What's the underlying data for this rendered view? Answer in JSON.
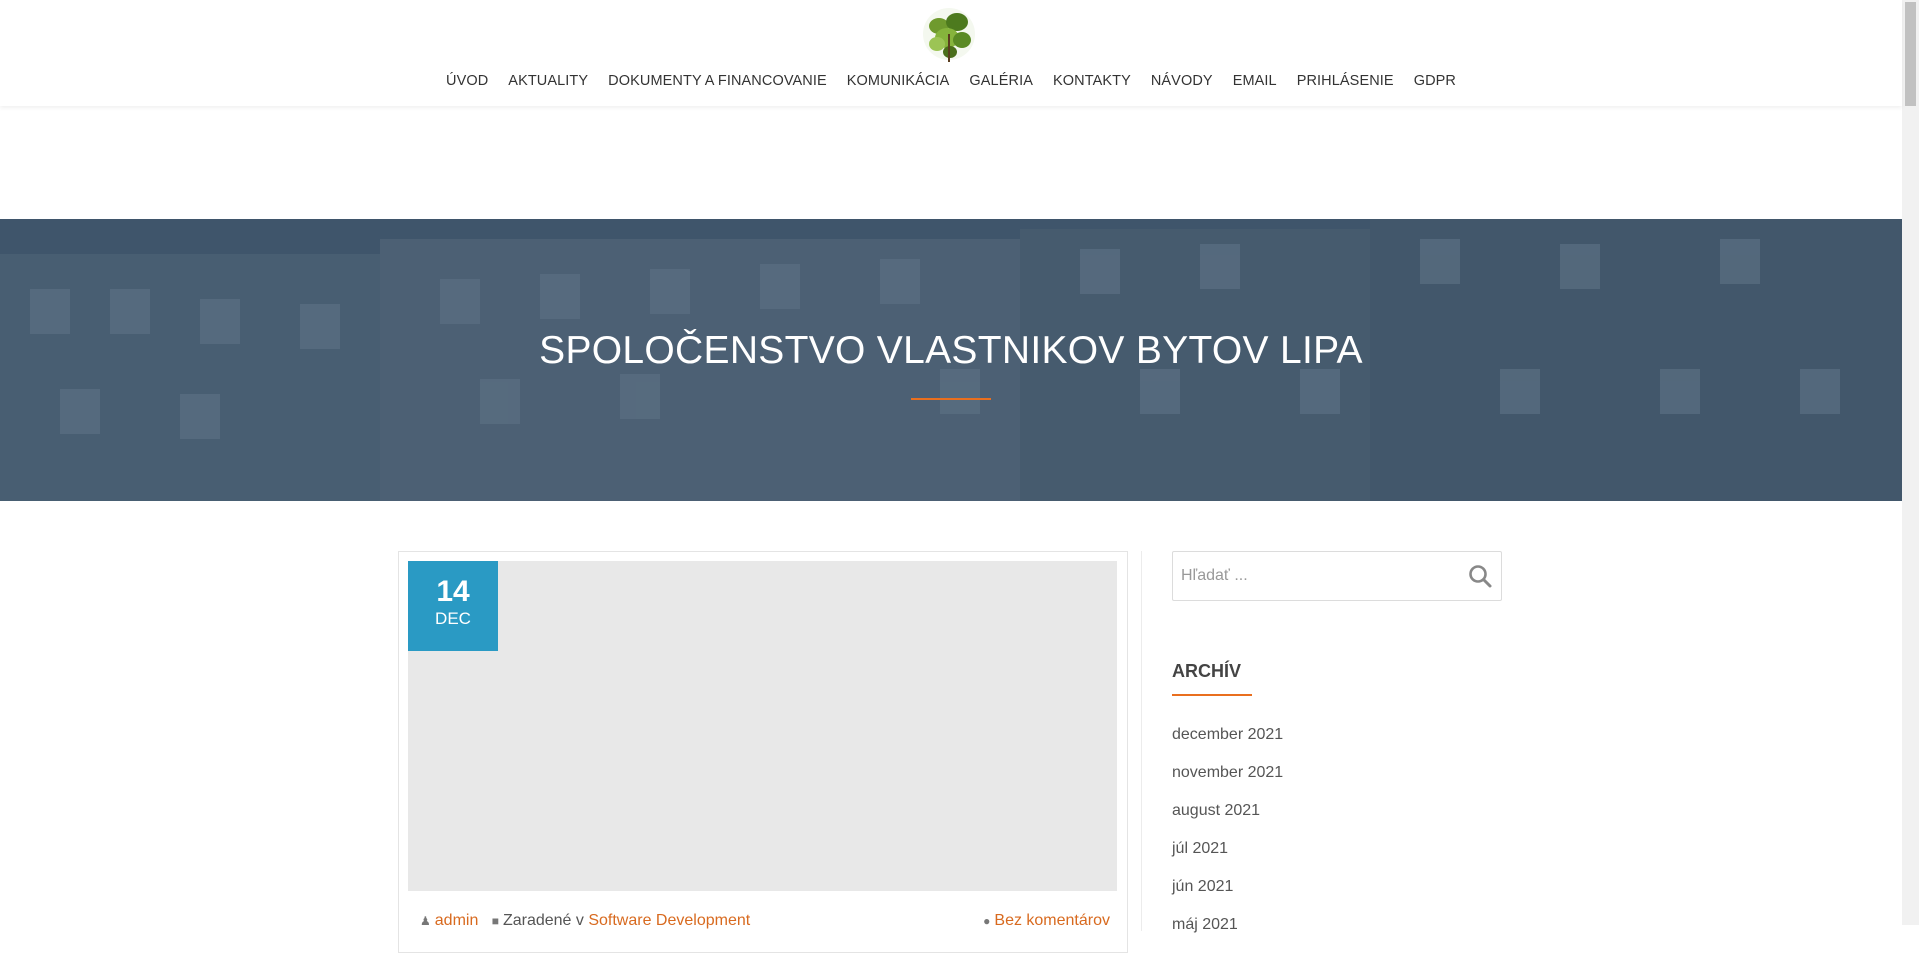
{
  "nav": {
    "items": [
      "ÚVOD",
      "AKTUALITY",
      "DOKUMENTY A FINANCOVANIE",
      "KOMUNIKÁCIA",
      "GALÉRIA",
      "KONTAKTY",
      "NÁVODY",
      "EMAIL",
      "PRIHLÁSENIE",
      "GDPR"
    ]
  },
  "hero": {
    "title": "SPOLOČENSTVO VLASTNIKOV BYTOV LIPA"
  },
  "post": {
    "day": "14",
    "month": "DEC",
    "author": "admin",
    "category_prefix": "Zaradené v",
    "category": "Software Development",
    "comments": "Bez komentárov"
  },
  "sidebar": {
    "search_placeholder": "Hľadať ...",
    "archive_title": "ARCHÍV",
    "archive": [
      "december 2021",
      "november 2021",
      "august 2021",
      "júl 2021",
      "jún 2021",
      "máj 2021"
    ]
  },
  "colors": {
    "accent": "#e96f1f",
    "date_box": "#2a9ac4",
    "link": "#d86a1f"
  }
}
